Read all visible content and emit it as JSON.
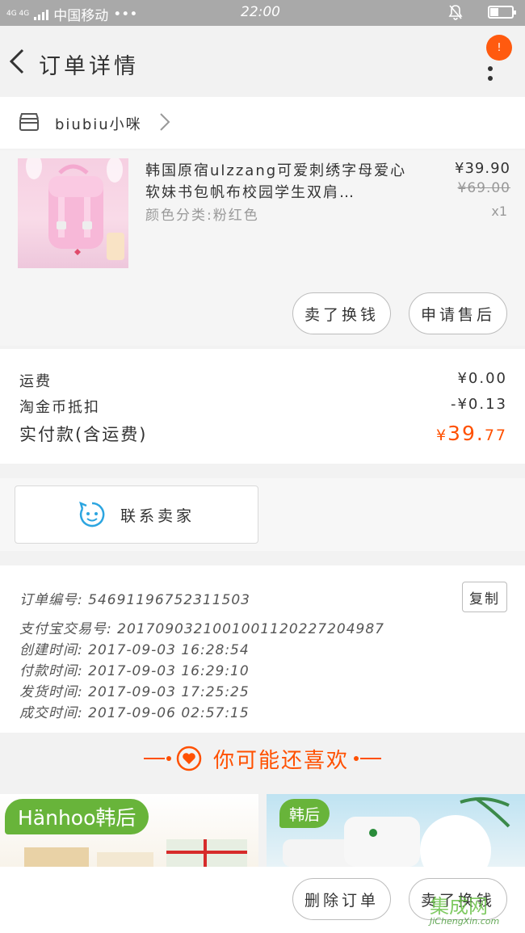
{
  "status_bar": {
    "network": "4G 4G",
    "carrier": "中国移动",
    "dots": "•••",
    "time": "22:00"
  },
  "nav": {
    "title": "订单详情",
    "badge": "!"
  },
  "shop": {
    "name": "biubiu小咪"
  },
  "item": {
    "title": "韩国原宿ulzzang可爱刺绣字母爱心软妹书包帆布校园学生双肩…",
    "spec": "颜色分类:粉红色",
    "price": "¥39.90",
    "original_price": "¥69.00",
    "quantity": "x1",
    "sell_button": "卖了换钱",
    "after_sale_button": "申请售后"
  },
  "fees": {
    "shipping_label": "运费",
    "shipping_value": "¥0.00",
    "coin_label": "淘金币抵扣",
    "coin_value": "-¥0.13",
    "total_label": "实付款(含运费)",
    "total_currency": "¥",
    "total_int": "39.",
    "total_dec": "77"
  },
  "contact": {
    "label": "联系卖家"
  },
  "order_info": {
    "order_no": "订单编号: 5469119675231​1503",
    "alipay_no": "支付宝交易号: 2017090321001001120227204987",
    "created": "创建时间: 2017-09-03 16:28:54",
    "paid": "付款时间: 2017-09-03 16:29:10",
    "shipped": "发货时间: 2017-09-03 17:25:25",
    "completed": "成交时间: 2017-09-06 02:57:15",
    "copy_button": "复制"
  },
  "recommend": {
    "title": "你可能还喜欢",
    "card_a_brand": "Hänhoo韩后",
    "card_b_brand": "韩后"
  },
  "bottom_bar": {
    "delete_button": "删除订单",
    "sell_button": "卖了换钱"
  },
  "watermark": {
    "cn": "集成网",
    "en": "JiChengXin.com"
  },
  "colors": {
    "accent": "#ff5000",
    "badge": "#ff5a0f",
    "contact_icon": "#2ca5e0",
    "brand_green": "#68b43a"
  }
}
